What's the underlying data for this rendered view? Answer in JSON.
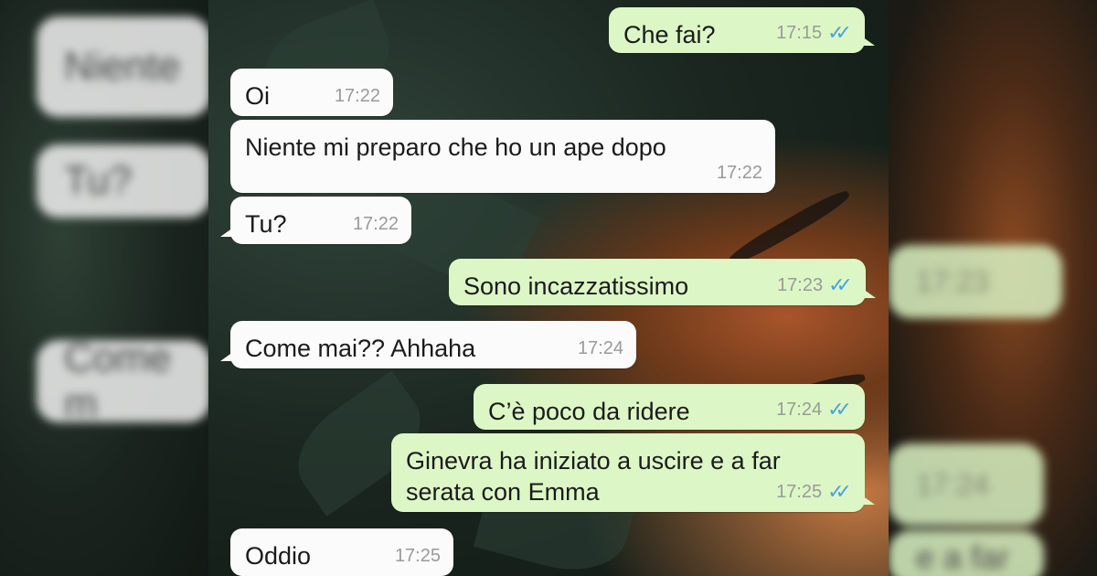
{
  "colors": {
    "incoming_bubble": "#fbfbfb",
    "outgoing_bubble": "#dcf7c5",
    "timestamp": "#9a9a9a",
    "read_ticks": "#4aa3e0"
  },
  "read_icon": "double-check-icon",
  "messages": [
    {
      "direction": "out",
      "text": "Che fai?",
      "time": "17:15",
      "read": true
    },
    {
      "direction": "in",
      "text": "Oi",
      "time": "17:22"
    },
    {
      "direction": "in",
      "text": "Niente mi preparo che ho un ape dopo",
      "time": "17:22"
    },
    {
      "direction": "in",
      "text": "Tu?",
      "time": "17:22"
    },
    {
      "direction": "out",
      "text": "Sono incazzatissimo",
      "time": "17:23",
      "read": true
    },
    {
      "direction": "in",
      "text": "Come mai?? Ahhaha",
      "time": "17:24"
    },
    {
      "direction": "out",
      "text": "C’è poco da ridere",
      "time": "17:24",
      "read": true
    },
    {
      "direction": "out",
      "text": "Ginevra ha iniziato a uscire e a far serata con Emma",
      "line1": "Ginevra ha iniziato a uscire e a far",
      "line2": "serata con Emma",
      "time": "17:25",
      "read": true
    },
    {
      "direction": "in",
      "text": "Oddio",
      "time": "17:25"
    }
  ],
  "blurred_left": [
    "Niente",
    "Tu?",
    "Come m"
  ],
  "blurred_right": [
    "17:23",
    "17:24",
    "e a far"
  ]
}
